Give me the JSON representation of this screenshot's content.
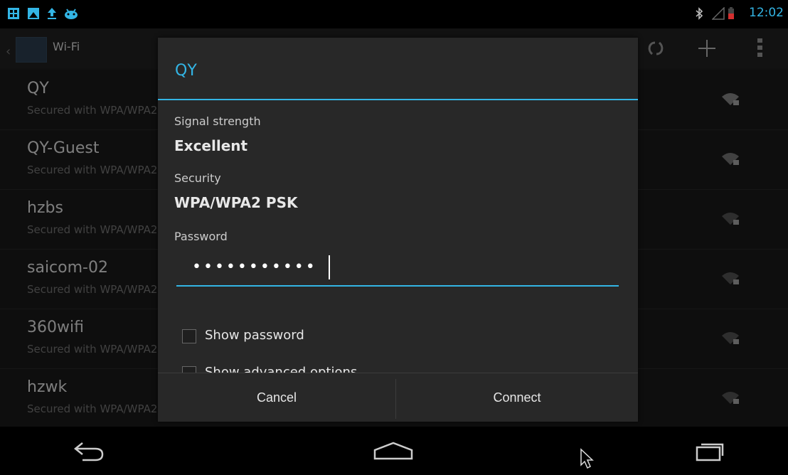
{
  "status_bar": {
    "time": "12:02",
    "left_icons": [
      "grid-icon",
      "image-icon",
      "upload-icon",
      "android-icon"
    ],
    "right_icons": [
      "bluetooth-icon",
      "cell-signal-icon",
      "battery-low-icon"
    ],
    "accent": "#33b5e5"
  },
  "action_bar": {
    "title": "Wi-Fi",
    "actions": [
      "wps-icon",
      "add-icon",
      "overflow-menu-icon"
    ]
  },
  "wifi_networks": [
    {
      "name": "QY",
      "security": "Secured with WPA/WPA2"
    },
    {
      "name": "QY-Guest",
      "security": "Secured with WPA/WPA2"
    },
    {
      "name": "hzbs",
      "security": "Secured with WPA/WPA2"
    },
    {
      "name": "saicom-02",
      "security": "Secured with WPA/WPA2"
    },
    {
      "name": "360wifi",
      "security": "Secured with WPA/WPA2"
    },
    {
      "name": "hzwk",
      "security": "Secured with WPA/WPA2"
    }
  ],
  "dialog": {
    "title": "QY",
    "signal_label": "Signal strength",
    "signal_value": "Excellent",
    "security_label": "Security",
    "security_value": "WPA/WPA2 PSK",
    "password_label": "Password",
    "password_masked": "•••••••••••",
    "show_password_label": "Show password",
    "show_advanced_label": "Show advanced options",
    "cancel_label": "Cancel",
    "connect_label": "Connect"
  },
  "nav_bar": {
    "buttons": [
      "back-icon",
      "home-icon",
      "recent-apps-icon"
    ]
  }
}
